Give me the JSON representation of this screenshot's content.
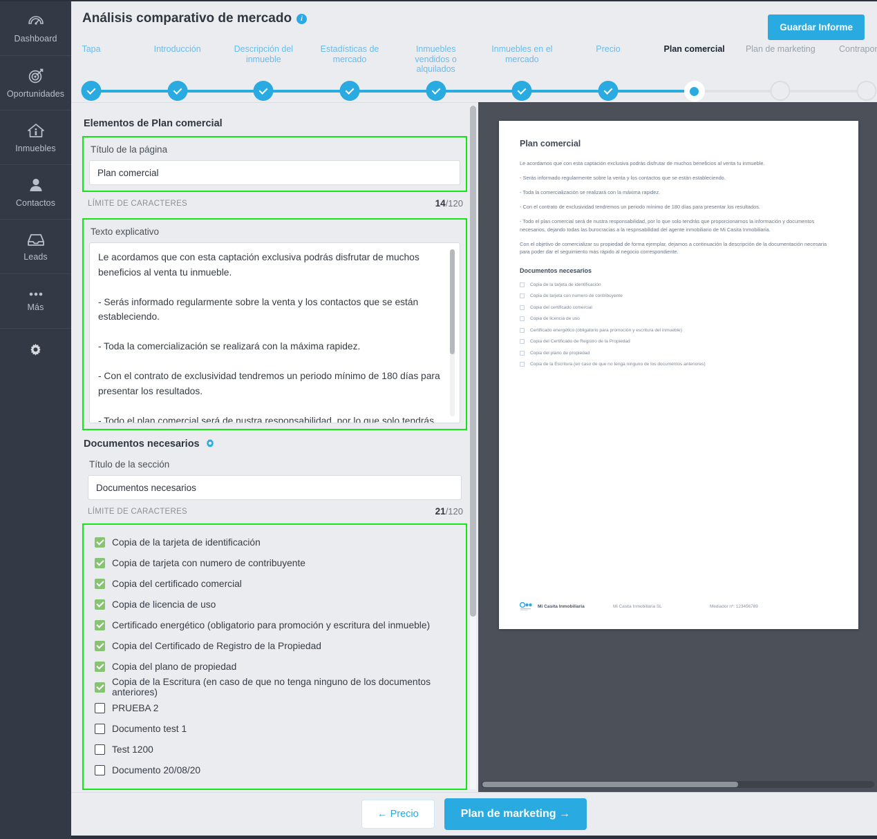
{
  "sidebar": {
    "items": [
      {
        "label": "Dashboard",
        "icon": "gauge-icon"
      },
      {
        "label": "Oportunidades",
        "icon": "target-icon"
      },
      {
        "label": "Inmuebles",
        "icon": "house-icon"
      },
      {
        "label": "Contactos",
        "icon": "person-icon"
      },
      {
        "label": "Leads",
        "icon": "inbox-icon"
      },
      {
        "label": "Más",
        "icon": "ellipsis-icon"
      }
    ],
    "settings_icon": "gear-icon"
  },
  "header": {
    "title": "Análisis comparativo de mercado",
    "info_icon": "info-icon",
    "save_label": "Guardar Informe"
  },
  "stepper": {
    "steps": [
      {
        "label": "Tapa",
        "state": "done"
      },
      {
        "label": "Introducción",
        "state": "done"
      },
      {
        "label": "Descripción del inmueble",
        "state": "done"
      },
      {
        "label": "Estadísticas de mercado",
        "state": "done"
      },
      {
        "label": "Inmuebles vendidos o alquilados",
        "state": "done"
      },
      {
        "label": "Inmuebles en el mercado",
        "state": "done"
      },
      {
        "label": "Precio",
        "state": "done"
      },
      {
        "label": "Plan comercial",
        "state": "current"
      },
      {
        "label": "Plan de marketing",
        "state": "future"
      },
      {
        "label": "Contraportada",
        "state": "future"
      }
    ]
  },
  "form": {
    "elements_title": "Elementos de Plan comercial",
    "page_title": {
      "label": "Título de la página",
      "value": "Plan comercial",
      "limit_label": "LÍMITE DE CARACTERES",
      "count": "14",
      "max": "/120"
    },
    "explanatory": {
      "label": "Texto explicativo",
      "value": "Le acordamos que con esta captación exclusiva podrás disfrutar de muchos beneficios al venta tu inmueble.\n\n- Serás informado regularmente sobre la venta y los contactos que se están estableciendo.\n\n- Toda la comercialización se realizará con la máxima rapidez.\n\n- Con el contrato de exclusividad tendremos un periodo mínimo de 180 días para presentar los resultados.\n\n- Todo el plan comercial será de nustra responsabilidad, por lo que solo tendrás que proporcionarnos la información y documentos necesarios, dejando todas las burocracias a la respnsabilidad del agente inmobiliario de Mi Casita Inmobiliaria."
    },
    "documents_section": {
      "title": "Documentos necesarios",
      "gear_icon": "gear-icon",
      "section_label": "Título de la sección",
      "section_value": "Documentos necesarios",
      "limit_label": "LÍMITE DE CARACTERES",
      "count": "21",
      "max": "/120"
    },
    "checkboxes": [
      {
        "label": "Copia de la tarjeta de identificación",
        "checked": true
      },
      {
        "label": "Copia de tarjeta con numero de contribuyente",
        "checked": true
      },
      {
        "label": "Copia del certificado comercial",
        "checked": true
      },
      {
        "label": "Copia de licencia de uso",
        "checked": true
      },
      {
        "label": "Certificado energético (obligatorio para promoción y escritura del inmueble)",
        "checked": true
      },
      {
        "label": "Copia del Certificado de Registro de la Propiedad",
        "checked": true
      },
      {
        "label": "Copia del plano de propiedad",
        "checked": true
      },
      {
        "label": "Copia de la Escritura (en caso de que no tenga ninguno de los documentos anteriores)",
        "checked": true
      },
      {
        "label": "PRUEBA 2",
        "checked": false
      },
      {
        "label": "Documento test 1",
        "checked": false
      },
      {
        "label": "Test 1200",
        "checked": false
      },
      {
        "label": "Documento 20/08/20",
        "checked": false
      }
    ]
  },
  "preview": {
    "heading": "Plan comercial",
    "paragraphs": [
      "Le acordamos que con esta captación exclusiva podrás disfrutar de muchos beneficios al venta tu inmueble.",
      "- Serás informado regularmente sobre la venta y los contactos que se están estableciendo.",
      "- Toda la comercialización se realizará con la máxima rapidez.",
      "- Con el contrato de exclusividad tendremos un periodo mínimo de 180 días para presentar los resultados.",
      "- Todo el plan comercial será de nustra responsabilidad, por lo que solo tendrás que proporcionarnos la información y documentos necesarios, dejando todas las burocracias a la respnsabilidad del agente inmobiliario de Mi Casita Inmobiliaria.",
      "Con el objetivo de comercializar su propiedad de forma ejemplar, dejamos a continuación la descripción de la documentación necesaria para poder dar el seguimiento más rápido al negocio correspondiente."
    ],
    "documents_heading": "Documentos necesarios",
    "documents": [
      "Copia de la tarjeta de identificación",
      "Copia de tarjeta con numero de contribuyente",
      "Copia del certificado comercial",
      "Copia de licencia de uso",
      "Certificado energético (obligatorio para promoción y escritura del inmueble)",
      "Copia del Certificado de Registro de la Propiedad",
      "Copia del plano de propiedad",
      "Copia de la Escritura (en caso de que no tenga ninguno de los documentos anteriores)"
    ],
    "footer": {
      "logo_icon": "company-logo-icon",
      "brand": "Mi Casita Inmobiliaria",
      "legal": "Mi Casita Inmobiliaria SL",
      "mediator": "Mediador nº: 123456789"
    }
  },
  "footer": {
    "prev_label": "← Precio",
    "next_label": "Plan de marketing →"
  },
  "colors": {
    "accent": "#29abe2",
    "sidebar": "#333a45",
    "preview_bg": "#4b5059",
    "highlight": "#13e713",
    "check_green": "#86c471"
  }
}
